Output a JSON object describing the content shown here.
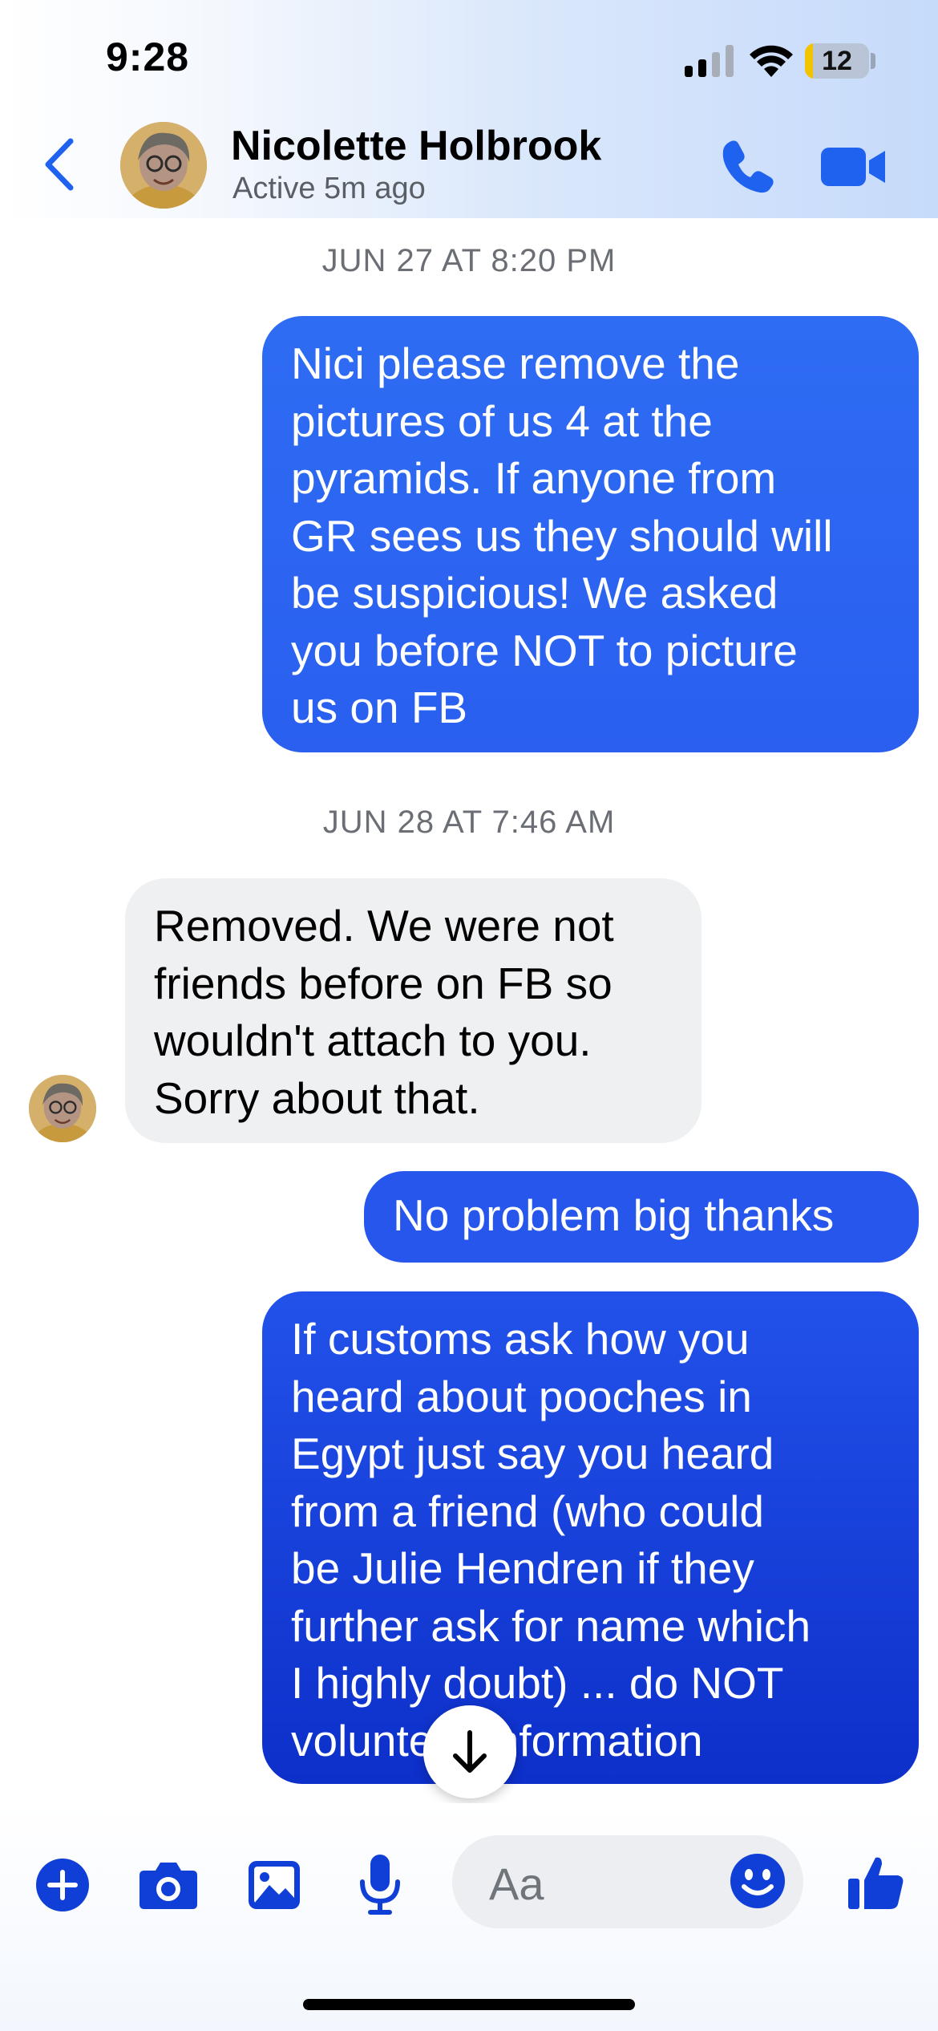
{
  "status_bar": {
    "time": "9:28",
    "battery_level": "12",
    "battery_fraction": 0.12
  },
  "header": {
    "contact_name": "Nicolette Holbrook",
    "contact_status": "Active 5m ago",
    "icons": [
      "back-chevron-icon",
      "phone-icon",
      "video-camera-icon"
    ]
  },
  "conversation": {
    "timestamp_1": "JUN 27 AT 8:20 PM",
    "timestamp_2": "JUN 28 AT 7:46 AM",
    "messages": [
      {
        "direction": "outgoing",
        "lines": [
          "Nici please remove the",
          "pictures of us 4 at the",
          "pyramids. If anyone from",
          "GR sees us they should will",
          "be suspicious! We asked",
          "you before NOT to picture",
          "us on FB"
        ]
      },
      {
        "direction": "incoming",
        "lines": [
          "Removed. We were not",
          "friends before on FB so",
          "wouldn't attach to you.",
          "Sorry about that."
        ]
      },
      {
        "direction": "outgoing",
        "lines": [
          "No problem big thanks"
        ]
      },
      {
        "direction": "outgoing",
        "lines": [
          "If customs ask how you",
          "heard about pooches in",
          "Egypt just say you heard",
          "from a friend (who could",
          "be Julie Hendren if they",
          "further ask for name which",
          "I highly doubt) ... do NOT",
          "volunteer information"
        ]
      }
    ]
  },
  "composer": {
    "placeholder": "Aa",
    "icons": [
      "plus-icon",
      "camera-icon",
      "photo-icon",
      "microphone-icon",
      "emoji-icon",
      "thumbs-up-icon"
    ]
  },
  "colors": {
    "accent": "#1f62ef",
    "bubble_out_top": "#2d64ee",
    "bubble_out_bottom": "#0c2cc9",
    "bubble_in": "#eff0f2",
    "icon_blue": "#0f3fd6"
  }
}
